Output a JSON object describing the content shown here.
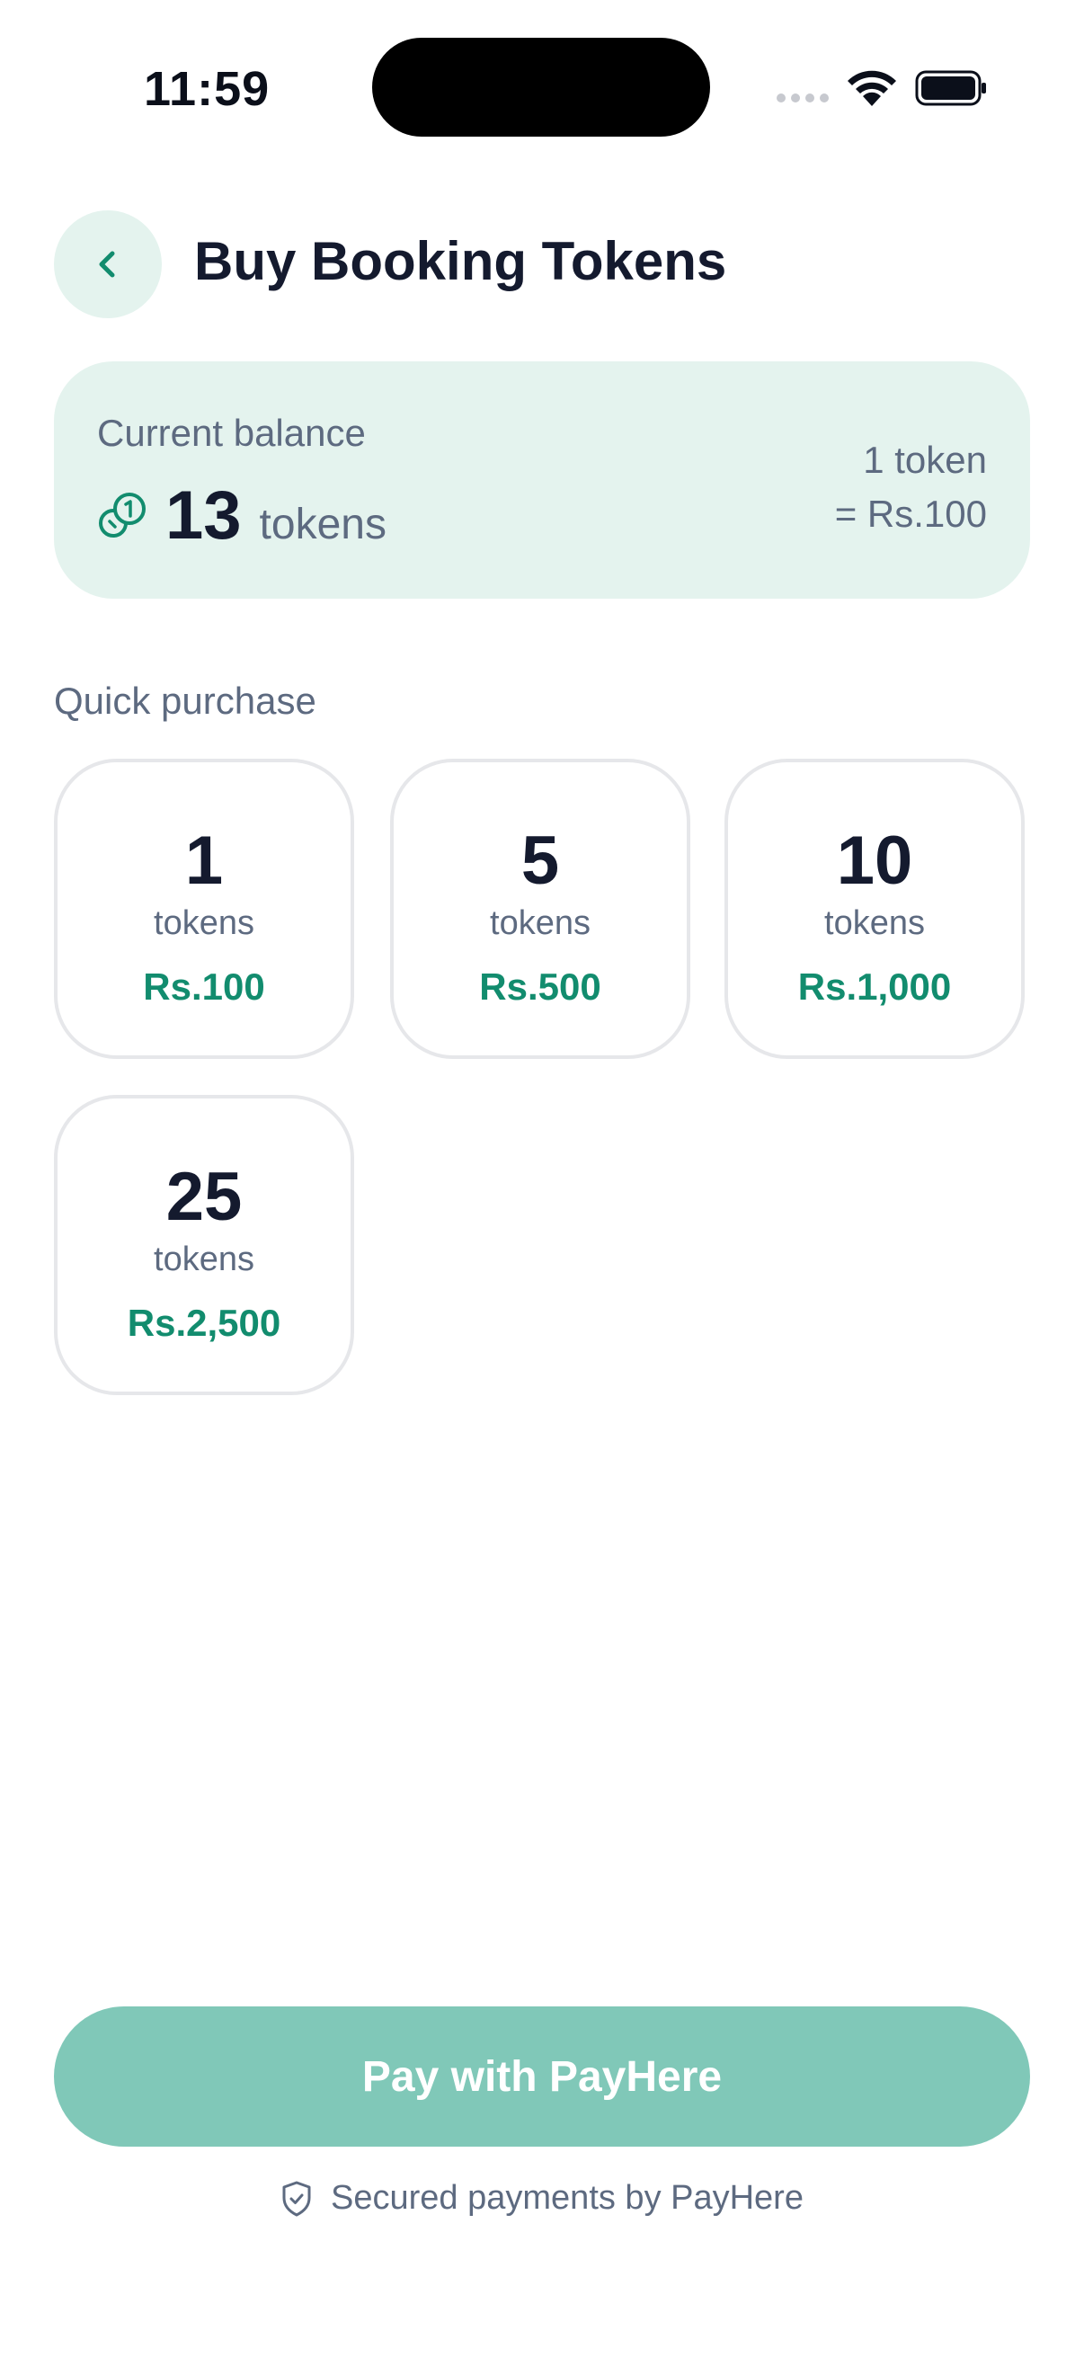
{
  "status_bar": {
    "time": "11:59"
  },
  "header": {
    "title": "Buy Booking Tokens"
  },
  "balance": {
    "label": "Current balance",
    "value": "13",
    "unit": "tokens",
    "rate_line1": "1 token",
    "rate_line2": "= Rs.100"
  },
  "quick_purchase": {
    "label": "Quick purchase",
    "packages": [
      {
        "count": "1",
        "unit": "tokens",
        "price": "Rs.100"
      },
      {
        "count": "5",
        "unit": "tokens",
        "price": "Rs.500"
      },
      {
        "count": "10",
        "unit": "tokens",
        "price": "Rs.1,000"
      },
      {
        "count": "25",
        "unit": "tokens",
        "price": "Rs.2,500"
      }
    ]
  },
  "pay": {
    "label": "Pay with PayHere",
    "secure_note": "Secured payments by PayHere"
  },
  "colors": {
    "accent": "#128c6e",
    "card_bg": "#e4f3ee",
    "button": "#80c8b8"
  }
}
